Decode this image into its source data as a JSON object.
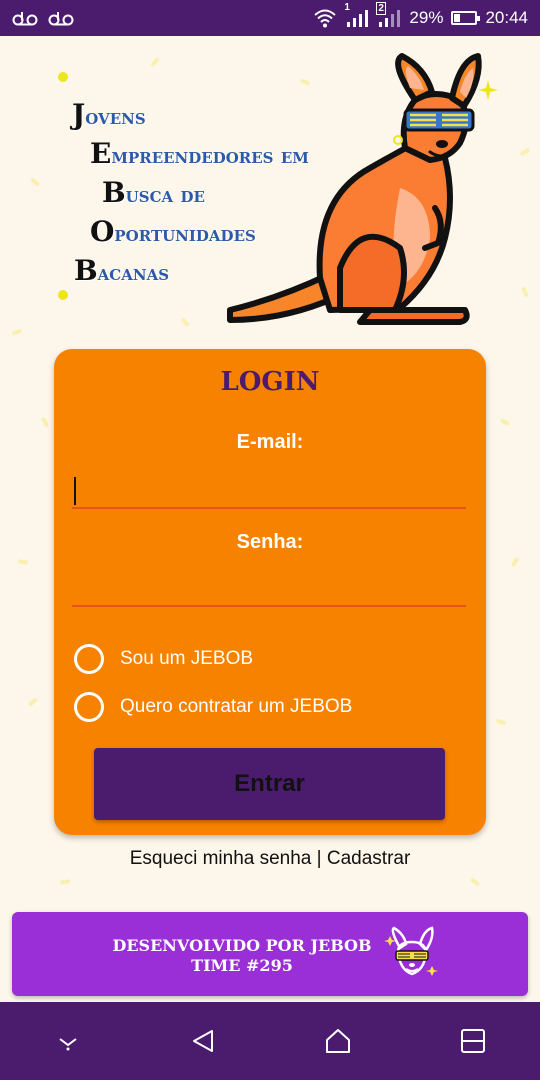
{
  "status_bar": {
    "battery_percent": "29%",
    "time": "20:44",
    "sim1_label": "1",
    "sim2_label": "2",
    "left_icons": [
      "voicemail-icon",
      "voicemail-icon"
    ],
    "right_icons": [
      "wifi-icon",
      "signal-icon",
      "signal-icon",
      "battery-icon"
    ]
  },
  "logo": {
    "lines": [
      {
        "cap": "J",
        "rest": "ovens"
      },
      {
        "cap": "E",
        "rest": "mpreendedores em"
      },
      {
        "cap": "B",
        "rest": "usca de"
      },
      {
        "cap": "O",
        "rest": "portunidades"
      },
      {
        "cap": "B",
        "rest": "acanas"
      }
    ]
  },
  "login": {
    "title": "LOGIN",
    "email_label": "E-mail:",
    "email_value": "",
    "password_label": "Senha:",
    "password_value": "",
    "radio_options": [
      "Sou um JEBOB",
      "Quero contratar um JEBOB"
    ],
    "submit_label": "Entrar"
  },
  "links": {
    "forgot_password": "Esqueci minha senha",
    "separator": " | ",
    "register": "Cadastrar"
  },
  "footer": {
    "line1": "DESENVOLVIDO POR JEBOB",
    "line2": "TIME #295"
  },
  "colors": {
    "primary_purple": "#4b1c6e",
    "card_orange": "#f78200",
    "footer_purple": "#9a2fd8",
    "logo_blue": "#2c5aa8",
    "background": "#fdf6ea"
  },
  "nav_bar": {
    "buttons": [
      "hide-keyboard-icon",
      "back-icon",
      "home-icon",
      "recents-icon"
    ]
  }
}
